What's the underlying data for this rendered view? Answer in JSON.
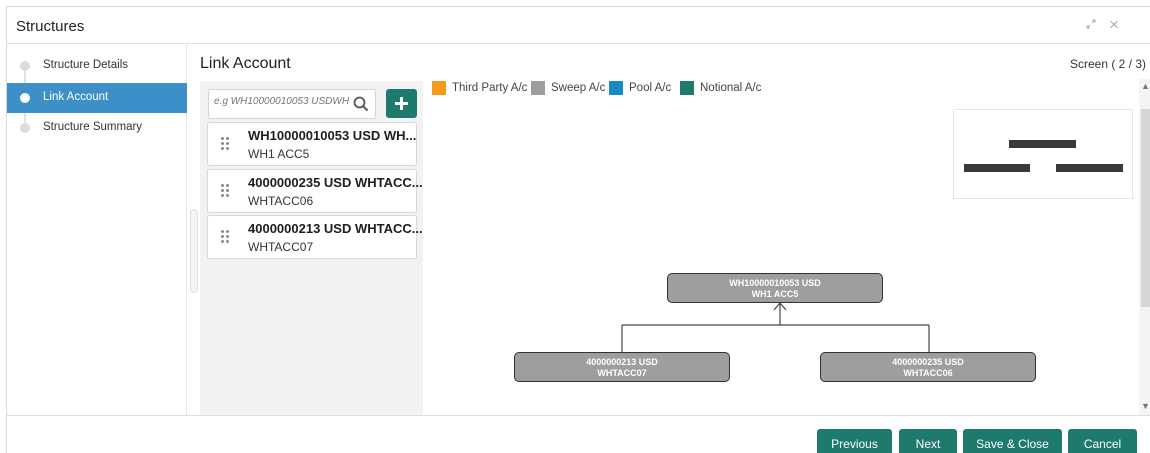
{
  "window": {
    "title": "Structures",
    "controls": {
      "minimize_icon": "↘↗",
      "close_icon": "×"
    }
  },
  "sidebar": {
    "items": [
      {
        "label": "Structure Details",
        "active": false
      },
      {
        "label": "Link Account",
        "active": true
      },
      {
        "label": "Structure Summary",
        "active": false
      }
    ]
  },
  "main": {
    "title": "Link Account",
    "screen_indicator": "Screen ( 2 / 3)"
  },
  "search": {
    "placeholder": "e.g WH10000010053 USDWH"
  },
  "accounts": [
    {
      "title": "WH10000010053 USD WH...",
      "sub": "WH1 ACC5"
    },
    {
      "title": "4000000235 USD WHTACC...",
      "sub": "WHTACC06"
    },
    {
      "title": "4000000213 USD WHTACC...",
      "sub": "WHTACC07"
    }
  ],
  "legend": [
    {
      "label": "Third Party A/c",
      "color": "#f39a1c"
    },
    {
      "label": "Sweep A/c",
      "color": "#9e9e9e"
    },
    {
      "label": "Pool A/c",
      "color": "#1a8ac6"
    },
    {
      "label": "Notional A/c",
      "color": "#1f7a6e"
    }
  ],
  "tree": {
    "root": {
      "line1": "WH10000010053 USD",
      "line2": "WH1 ACC5"
    },
    "children": [
      {
        "line1": "4000000213 USD",
        "line2": "WHTACC07"
      },
      {
        "line1": "4000000235 USD",
        "line2": "WHTACC06"
      }
    ]
  },
  "footer": {
    "previous": "Previous",
    "next": "Next",
    "save_close": "Save & Close",
    "cancel": "Cancel"
  }
}
